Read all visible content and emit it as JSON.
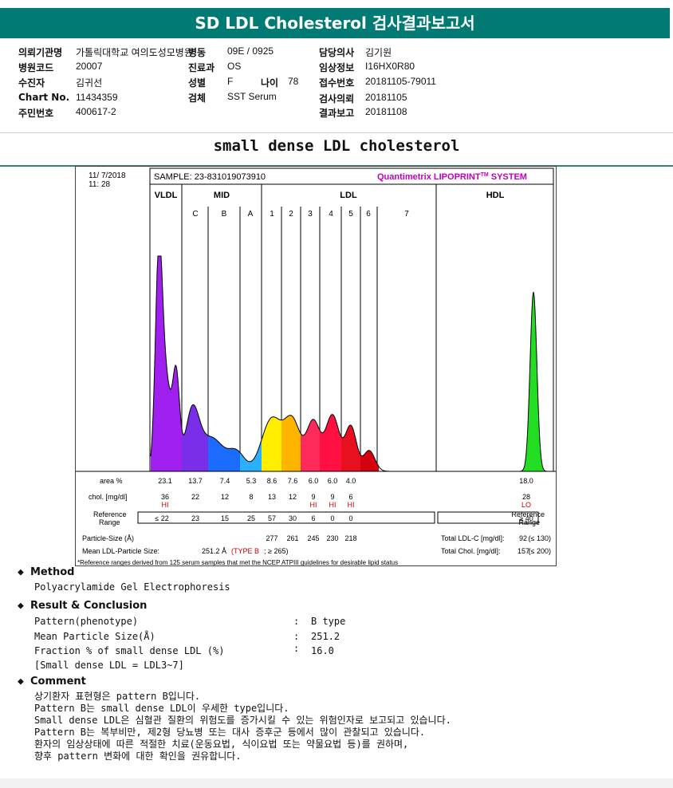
{
  "header": {
    "title": "SD LDL Cholesterol 검사결과보고서"
  },
  "info": {
    "col1": [
      {
        "label": "의뢰기관명",
        "value": "가톨릭대학교 여의도성모병원"
      },
      {
        "label": "병원코드",
        "value": "20007"
      },
      {
        "label": "수진자",
        "value": "김귀선"
      },
      {
        "label": "Chart No.",
        "value": "11434359"
      },
      {
        "label": "주민번호",
        "value": "400617-2"
      }
    ],
    "col2": [
      {
        "label": "병동",
        "value": "09E / 0925"
      },
      {
        "label": "진료과",
        "value": "OS"
      },
      {
        "label": "성별",
        "value": "F"
      },
      {
        "label": "검체",
        "value": "SST Serum"
      }
    ],
    "age": {
      "label": "나이",
      "value": "78"
    },
    "col3": [
      {
        "label": "담당의사",
        "value": "김기원"
      },
      {
        "label": "임상정보",
        "value": "I16HX0R80"
      },
      {
        "label": "접수번호",
        "value": "20181105-79011"
      },
      {
        "label": "검사의뢰",
        "value": "20181105"
      },
      {
        "label": "결과보고",
        "value": "20181108"
      }
    ]
  },
  "subtitle": "small dense LDL cholesterol",
  "report": {
    "date": "11/ 7/2018",
    "time": "11: 28",
    "sample": "SAMPLE:   23-831019073910",
    "system": "Quantimetrix LIPOPRINT",
    "system_tm": "TM",
    "system_suffix": " SYSTEM",
    "groups": [
      "VLDL",
      "MID",
      "LDL",
      "HDL"
    ],
    "bands": [
      "C",
      "B",
      "A",
      "1",
      "2",
      "3",
      "4",
      "5",
      "6",
      "7"
    ],
    "area_label": "area %",
    "chol_label": "chol. [mg/dl]",
    "ref_label_1": "Reference",
    "ref_label_2": "Range",
    "ref_right_1": "Reference",
    "ref_right_2": "Range",
    "area_values": [
      "23.1",
      "13.7",
      "7.4",
      "5.3",
      "8.6",
      "7.6",
      "6.0",
      "6.0",
      "4.0"
    ],
    "area_hdl": "18.0",
    "chol_values": [
      "36",
      "22",
      "12",
      "8",
      "13",
      "12",
      "9",
      "9",
      "6"
    ],
    "chol_hdl": "28",
    "chol_flags": [
      "HI",
      "",
      "",
      "",
      "",
      "",
      "HI",
      "HI",
      "HI"
    ],
    "chol_hdl_flag": "LO",
    "ref_values": [
      "≤ 22",
      "23",
      "15",
      "25",
      "57",
      "30",
      "6",
      "0",
      "0"
    ],
    "ref_hdl": "≥ 40",
    "particle_label": "Particle-Size (Å)",
    "particle_values": [
      "277",
      "261",
      "245",
      "230",
      "218"
    ],
    "mean_label": "Mean LDL-Particle Size:",
    "mean_value": "251.2 Å",
    "mean_type": "(TYPE B",
    "mean_limit": "; ≥ 265)",
    "total_ldl_label": "Total LDL-C [mg/dl]:",
    "total_ldl_value": "92",
    "total_ldl_ref": "(≤ 130)",
    "total_chol_label": "Total Chol. [mg/dl]:",
    "total_chol_value": "157",
    "total_chol_ref": "(≤ 200)",
    "footnote": "*Reference ranges derived from 125 serum samples that met the NCEP ATPIII guidelines for desirable lipid status"
  },
  "method": {
    "title": "Method",
    "text": "Polyacrylamide Gel Electrophoresis"
  },
  "result": {
    "title": "Result & Conclusion",
    "rows": [
      {
        "label": "Pattern(phenotype)",
        "value": "B type"
      },
      {
        "label": "Mean Particle Size(Å)",
        "value": "251.2"
      },
      {
        "label": "Fraction % of small dense LDL (%)",
        "value": "16.0"
      }
    ],
    "note": "[Small dense LDL = LDL3~7]"
  },
  "comment": {
    "title": "Comment",
    "lines": [
      "상기환자 표현형은 pattern B입니다.",
      "Pattern B는 small dense LDL이 우세한 type입니다.",
      "Small dense LDL은 심혈관 질환의 위험도를 증가시킬 수 있는 위험인자로 보고되고 있습니다.",
      "Pattern B는 복부비만, 제2형 당뇨병 또는 대사 증후군 등에서 많이 관찰되고 있습니다.",
      "환자의 임상상태에 따른 적절한 치료(운동요법, 식이요법 또는 약물요법 등)를 권하며,",
      "향후 pattern 변화에 대한 확인을 권유합니다."
    ]
  },
  "colors": {
    "header": "#007a73",
    "vldl": "#a020f0",
    "hdl": "#22dd22",
    "flag": "#cc0000",
    "system": "#c000c0"
  }
}
